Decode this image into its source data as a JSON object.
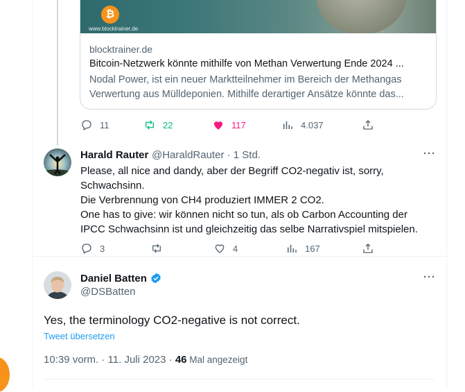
{
  "card": {
    "image_url_text": "www.blocktrainer.de",
    "btc_symbol": "₿",
    "domain": "blocktrainer.de",
    "title": "Bitcoin-Netzwerk könnte mithilfe von Methan Verwertung Ende 2024 ...",
    "description_line1": "Nodal Power, ist ein neuer Marktteilnehmer im Bereich der Methangas",
    "description_line2": "Verwertung aus Mülldeponien. Mithilfe derartiger Ansätze könnte das..."
  },
  "tweet1_actions": {
    "replies": "11",
    "retweets": "22",
    "likes": "117",
    "views": "4.037"
  },
  "reply": {
    "name": "Harald Rauter",
    "meta": "@HaraldRauter · 1 Std.",
    "more": "···",
    "lines": [
      "Please, all nice and dandy, aber der Begriff CO2-negativ ist, sorry,",
      "Schwachsinn.",
      "Die Verbrennung von CH4 produziert IMMER 2 CO2.",
      "One has to give: wir können nicht so tun, als ob Carbon Accounting der",
      "IPCC Schwachsinn ist und gleichzeitig das selbe Narrativspiel mitspielen."
    ],
    "actions": {
      "replies": "3",
      "retweets": "",
      "likes": "4",
      "views": "167"
    }
  },
  "main": {
    "name": "Daniel Batten",
    "handle": "@DSBatten",
    "more": "···",
    "text": "Yes, the terminology CO2-negative is not correct.",
    "translate": "Tweet übersetzen",
    "timestamp": "10:39 vorm. · 11. Juli 2023 · ",
    "views_count": "46",
    "views_label": " Mal angezeigt"
  },
  "colors": {
    "retweet_green": "#00ba7c",
    "like_pink": "#f91880",
    "link_blue": "#1d9bf0",
    "verified_blue": "#1d9bf0"
  }
}
